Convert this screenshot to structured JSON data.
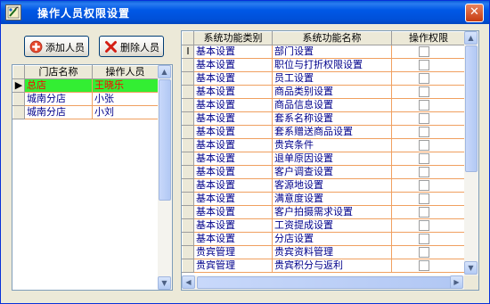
{
  "window": {
    "title": "操作人员权限设置",
    "close_glyph": "✕"
  },
  "toolbar": {
    "add_label": "添加人员",
    "delete_label": "删除人员"
  },
  "staff_table": {
    "columns": [
      "门店名称",
      "操作人员"
    ],
    "rows": [
      {
        "store": "总店",
        "operator": "王晓乐",
        "selected": true
      },
      {
        "store": "城南分店",
        "operator": "小张",
        "selected": false
      },
      {
        "store": "城南分店",
        "operator": "小刘",
        "selected": false
      }
    ]
  },
  "permission_table": {
    "columns": [
      "系统功能类别",
      "系统功能名称",
      "操作权限"
    ],
    "rows": [
      {
        "category": "基本设置",
        "name": "部门设置"
      },
      {
        "category": "基本设置",
        "name": "职位与打折权限设置"
      },
      {
        "category": "基本设置",
        "name": "员工设置"
      },
      {
        "category": "基本设置",
        "name": "商品类别设置"
      },
      {
        "category": "基本设置",
        "name": "商品信息设置"
      },
      {
        "category": "基本设置",
        "name": "套系名称设置"
      },
      {
        "category": "基本设置",
        "name": "套系赠送商品设置"
      },
      {
        "category": "基本设置",
        "name": "贵宾条件"
      },
      {
        "category": "基本设置",
        "name": "退单原因设置"
      },
      {
        "category": "基本设置",
        "name": "客户调查设置"
      },
      {
        "category": "基本设置",
        "name": "客源地设置"
      },
      {
        "category": "基本设置",
        "name": "满意度设置"
      },
      {
        "category": "基本设置",
        "name": "客户拍摄需求设置"
      },
      {
        "category": "基本设置",
        "name": "工资提成设置"
      },
      {
        "category": "基本设置",
        "name": "分店设置"
      },
      {
        "category": "贵宾管理",
        "name": "贵宾资料管理"
      },
      {
        "category": "贵宾管理",
        "name": "贵宾积分与返利"
      }
    ]
  },
  "icons": {
    "app": "app-icon",
    "add": "plus-icon",
    "delete": "x-icon",
    "row_pointer": "pointer-icon",
    "edit_cursor": "text-cursor-icon",
    "scroll_up": "▲",
    "scroll_down": "▼",
    "scroll_left": "◀",
    "scroll_right": "▶",
    "current_row": "▶",
    "edit_row": "I"
  },
  "colors": {
    "selected_row_bg": "#33ee33",
    "selected_row_text": "#ff0000",
    "cell_text": "#00008b",
    "grid_line": "#f0a060"
  }
}
